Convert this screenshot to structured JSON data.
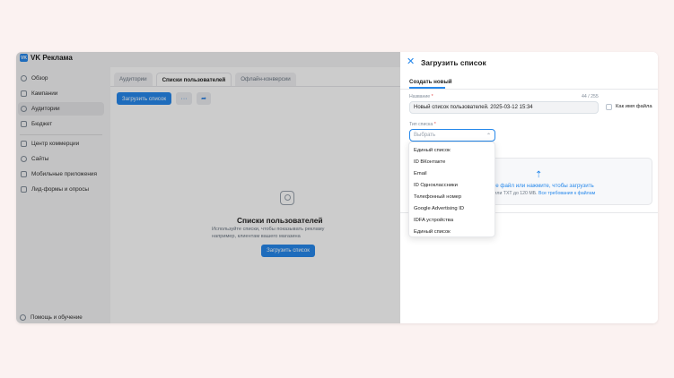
{
  "app": {
    "logo": "VK Реклама"
  },
  "sidebar": {
    "items": [
      {
        "label": "Обзор",
        "icon": "overview-icon"
      },
      {
        "label": "Кампании",
        "icon": "campaigns-icon"
      },
      {
        "label": "Аудитории",
        "icon": "audiences-icon"
      },
      {
        "label": "Бюджет",
        "icon": "budget-icon"
      },
      {
        "label": "Центр коммерции",
        "icon": "commerce-icon"
      },
      {
        "label": "Сайты",
        "icon": "sites-icon"
      },
      {
        "label": "Мобильные приложения",
        "icon": "mobile-apps-icon"
      },
      {
        "label": "Лид-формы и опросы",
        "icon": "lead-forms-icon"
      }
    ],
    "help": "Помощь и обучение"
  },
  "content": {
    "tabs": [
      "Аудитории",
      "Списки пользователей",
      "Офлайн-конверсии"
    ],
    "upload_button": "Загрузить список",
    "more_button": "···",
    "empty_title": "Списки пользователей",
    "empty_desc_1": "Используйте списки, чтобы показывать рекламу",
    "empty_desc_2": "например, клиентам вашего магазина",
    "empty_button": "Загрузить список"
  },
  "panel": {
    "title": "Загрузить список",
    "tab": "Создать новый",
    "name_label": "Название",
    "counter": "44 / 255",
    "name_value": "Новый список пользователей. 2025-03-12 15:34",
    "checkbox_label": "Как имя файла",
    "type_label": "Тип списка",
    "required_mark": "*",
    "select_placeholder": "Выбрать",
    "dropzone_text": "ите файл или нажмите, чтобы загрузить",
    "dropzone_sub": "T или TXT до 120 МБ.",
    "dropzone_link": "Все требования к файлам",
    "dropdown": [
      "Единый список",
      "ID ВКонтакте",
      "Email",
      "ID Одноклассники",
      "Телефонный номер",
      "Google Advertising ID",
      "IDFA устройства",
      "Единый список"
    ]
  },
  "colors": {
    "accent": "#2688eb",
    "background": "#fbf2f1"
  }
}
